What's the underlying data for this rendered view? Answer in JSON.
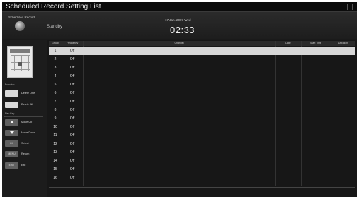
{
  "window": {
    "title": "Scheduled Record Setting List"
  },
  "header": {
    "mode_label": "Scheduled Record",
    "status": "Standby",
    "date": "17 Jan. 2007 Wed",
    "time": "02:33"
  },
  "sidebar": {
    "function_label": "Function",
    "delete_one_label": "Delete One",
    "delete_all_label": "Delete All",
    "nav_label": "Nav Key",
    "move_up_label": "Move Up",
    "move_down_label": "Move Down",
    "ok_key": "OK",
    "select_label": "Select",
    "menu_key": "MENU",
    "return_label": "Return",
    "exit_key": "EXIT",
    "exit_label": "Exit"
  },
  "table": {
    "columns": [
      "Group",
      "Frequency",
      "Channel",
      "Date",
      "Start Time",
      "Duration"
    ],
    "rows": [
      {
        "group": "1",
        "frequency": "Off"
      },
      {
        "group": "2",
        "frequency": "Off"
      },
      {
        "group": "3",
        "frequency": "Off"
      },
      {
        "group": "4",
        "frequency": "Off"
      },
      {
        "group": "5",
        "frequency": "Off"
      },
      {
        "group": "6",
        "frequency": "Off"
      },
      {
        "group": "7",
        "frequency": "Off"
      },
      {
        "group": "8",
        "frequency": "Off"
      },
      {
        "group": "9",
        "frequency": "Off"
      },
      {
        "group": "10",
        "frequency": "Off"
      },
      {
        "group": "11",
        "frequency": "Off"
      },
      {
        "group": "12",
        "frequency": "Off"
      },
      {
        "group": "13",
        "frequency": "Off"
      },
      {
        "group": "14",
        "frequency": "Off"
      },
      {
        "group": "15",
        "frequency": "Off"
      },
      {
        "group": "16",
        "frequency": "Off"
      }
    ]
  }
}
